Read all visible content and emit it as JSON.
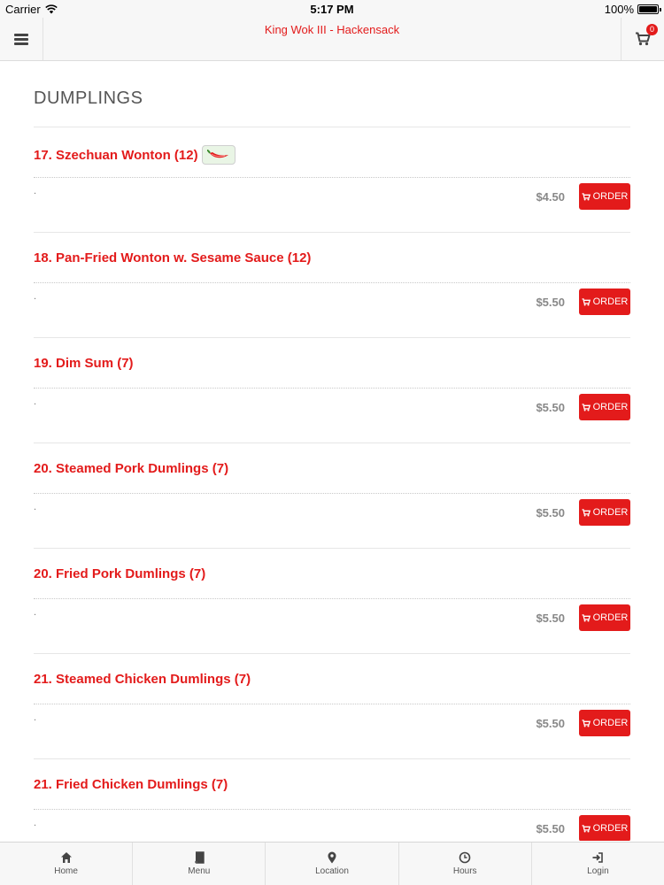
{
  "status_bar": {
    "carrier": "Carrier",
    "time": "5:17 PM",
    "battery": "100%"
  },
  "header": {
    "title": "King Wok III - Hackensack",
    "cart_count": "0"
  },
  "section": {
    "title": "DUMPLINGS"
  },
  "items": [
    {
      "name": "17. Szechuan Wonton (12)",
      "spicy": true,
      "desc": ".",
      "price": "$4.50",
      "order_label": "ORDER"
    },
    {
      "name": "18. Pan-Fried Wonton w. Sesame Sauce (12)",
      "spicy": false,
      "desc": ".",
      "price": "$5.50",
      "order_label": "ORDER"
    },
    {
      "name": "19. Dim Sum (7)",
      "spicy": false,
      "desc": ".",
      "price": "$5.50",
      "order_label": "ORDER"
    },
    {
      "name": "20. Steamed Pork Dumlings (7)",
      "spicy": false,
      "desc": ".",
      "price": "$5.50",
      "order_label": "ORDER"
    },
    {
      "name": "20. Fried Pork Dumlings (7)",
      "spicy": false,
      "desc": ".",
      "price": "$5.50",
      "order_label": "ORDER"
    },
    {
      "name": "21. Steamed Chicken Dumlings (7)",
      "spicy": false,
      "desc": ".",
      "price": "$5.50",
      "order_label": "ORDER"
    },
    {
      "name": "21. Fried Chicken Dumlings (7)",
      "spicy": false,
      "desc": ".",
      "price": "$5.50",
      "order_label": "ORDER"
    }
  ],
  "tabbar": {
    "tabs": [
      {
        "label": "Home",
        "icon": "home-icon"
      },
      {
        "label": "Menu",
        "icon": "book-icon"
      },
      {
        "label": "Location",
        "icon": "map-marker-icon"
      },
      {
        "label": "Hours",
        "icon": "clock-icon"
      },
      {
        "label": "Login",
        "icon": "sign-in-icon"
      }
    ]
  },
  "colors": {
    "accent": "#e31b1b",
    "price": "#888888",
    "bar_bg": "#f7f7f7"
  }
}
